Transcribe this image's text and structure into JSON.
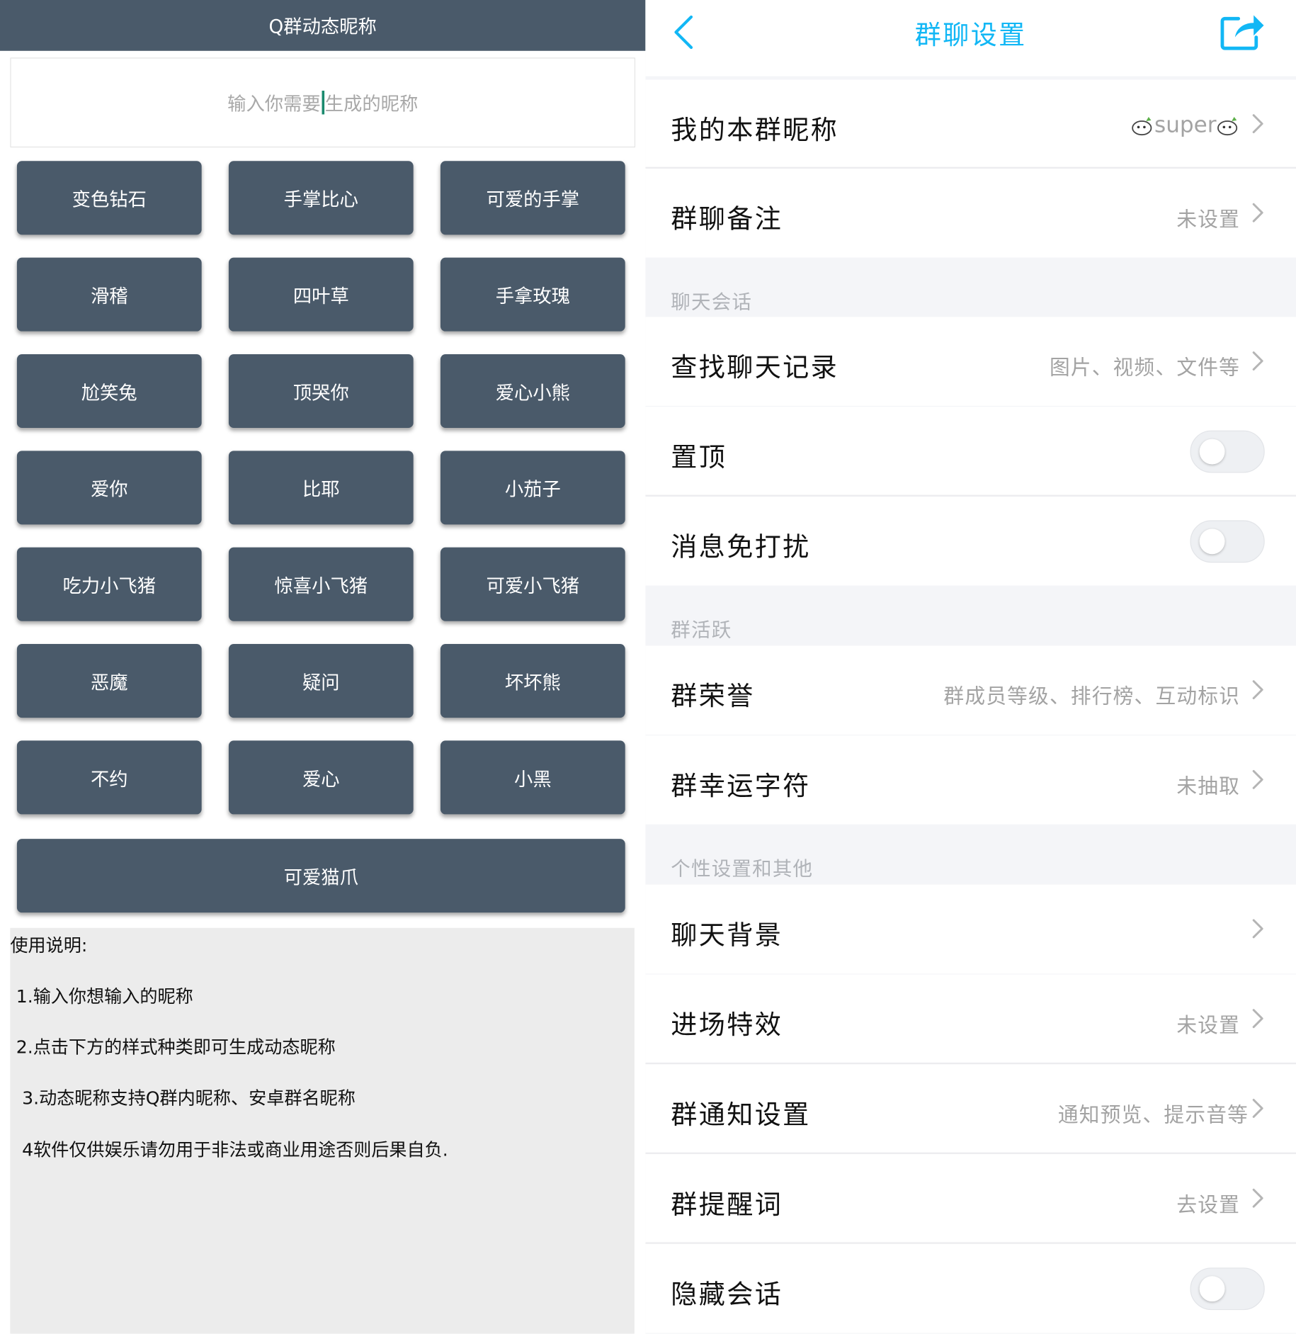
{
  "left": {
    "header_title": "Q群动态昵称",
    "input": {
      "text_before": "输入你需要",
      "text_after": "生成的昵称"
    },
    "buttons": [
      "变色钻石",
      "手掌比心",
      "可爱的手掌",
      "滑稽",
      "四叶草",
      "手拿玫瑰",
      "尬笑兔",
      "顶哭你",
      "爱心小熊",
      "爱你",
      "比耶",
      "小茄子",
      "吃力小飞猪",
      "惊喜小飞猪",
      "可爱小飞猪",
      "恶魔",
      "疑问",
      "坏坏熊",
      "不约",
      "爱心",
      "小黑"
    ],
    "wide_button": "可爱猫爪",
    "instructions": {
      "heading": "使用说明:",
      "lines": [
        "1.输入你想输入的昵称",
        "2.点击下方的样式种类即可生成动态昵称",
        "3.动态昵称支持Q群内昵称、安卓群名昵称",
        "4软件仅供娱乐请勿用于非法或商业用途否则后果自负."
      ]
    }
  },
  "right": {
    "header": {
      "title": "群聊设置",
      "accent": "#12b7f5"
    },
    "icons": {
      "back": "chevron-left-icon",
      "share": "share-icon"
    },
    "my_nickname": {
      "label": "我的本群昵称",
      "value": "super"
    },
    "remark": {
      "label": "群聊备注",
      "value": "未设置"
    },
    "sections": {
      "chat": "聊天会话",
      "activity": "群活跃",
      "personal": "个性设置和其他"
    },
    "search_history": {
      "label": "查找聊天记录",
      "value": "图片、视频、文件等"
    },
    "pin_top": {
      "label": "置顶",
      "on": false
    },
    "do_not_disturb": {
      "label": "消息免打扰",
      "on": false
    },
    "honor": {
      "label": "群荣誉",
      "value": "群成员等级、排行榜、互动标识"
    },
    "lucky_char": {
      "label": "群幸运字符",
      "value": "未抽取"
    },
    "chat_background": {
      "label": "聊天背景",
      "value": ""
    },
    "entry_effect": {
      "label": "进场特效",
      "value": "未设置"
    },
    "notification": {
      "label": "群通知设置",
      "value": "通知预览、提示音等"
    },
    "reminder_word": {
      "label": "群提醒词",
      "value": "去设置"
    },
    "hide_chat": {
      "label": "隐藏会话",
      "on": false
    }
  }
}
